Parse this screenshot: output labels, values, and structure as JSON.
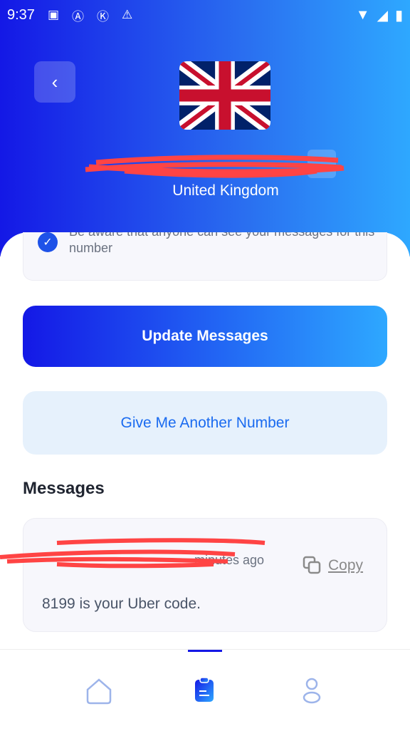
{
  "status_bar": {
    "time": "9:37",
    "icons": [
      "image-icon",
      "text-a-icon",
      "k-circle-icon",
      "warning-icon",
      "wifi-icon",
      "signal-icon",
      "battery-charging-icon"
    ]
  },
  "header": {
    "country": "United Kingdom",
    "flag": "uk-flag",
    "back_icon": "chevron-left-icon"
  },
  "notice": {
    "text": "Be aware that anyone can see your messages for this number"
  },
  "buttons": {
    "update": "Update Messages",
    "another": "Give Me Another Number"
  },
  "messages": {
    "title": "Messages",
    "items": [
      {
        "time": "minutes ago",
        "copy_label": "Copy",
        "body": "8199 is your Uber code."
      }
    ]
  },
  "nav": {
    "items": [
      "home-icon",
      "clipboard-icon",
      "profile-icon"
    ],
    "active": 1
  },
  "colors": {
    "gradient_start": "#1418e6",
    "gradient_end": "#2ea8ff",
    "accent": "#1a6bf0",
    "redaction": "#ff4444"
  }
}
